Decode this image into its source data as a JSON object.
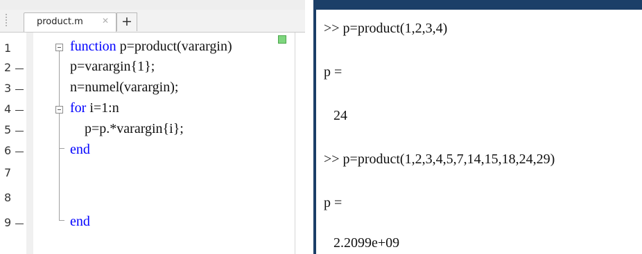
{
  "editor": {
    "tab": {
      "label": "product.m",
      "close_glyph": "✕",
      "add_glyph": "+"
    },
    "line_numbers": [
      "1",
      "2",
      "3",
      "4",
      "5",
      "6",
      "7",
      "8",
      "9"
    ],
    "code": {
      "line1_kw": "function",
      "line1_rest": " p=product(varargin)",
      "line2": "p=varargin{1};",
      "line3": "n=numel(varargin);",
      "line4_kw": "for",
      "line4_rest": " i=1:n",
      "line5": "p=p.*varargin{i};",
      "line6_kw": "end",
      "line9_kw": "end"
    },
    "status_color": "#7ed67e",
    "keyword_color": "#0000ff"
  },
  "console": {
    "lines": {
      "cmd1": ">> p=product(1,2,3,4)",
      "out1_label": "p =",
      "out1_value": "24",
      "cmd2": ">> p=product(1,2,3,4,5,7,14,15,18,24,29)",
      "out2_label": "p =",
      "out2_value": "2.2099e+09"
    },
    "border_color": "#1b3f68"
  }
}
